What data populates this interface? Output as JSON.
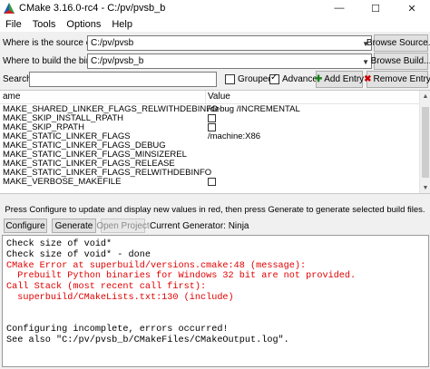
{
  "window": {
    "title": "CMake 3.16.0-rc4 - C:/pv/pvsb_b",
    "controls": {
      "minimize": "—",
      "maximize": "☐",
      "close": "✕"
    }
  },
  "menu": [
    "File",
    "Tools",
    "Options",
    "Help"
  ],
  "source": {
    "label": "Where is the source code:",
    "value": "C:/pv/pvsb",
    "button": "Browse Source..."
  },
  "build": {
    "label": "Where to build the binaries:",
    "value": "C:/pv/pvsb_b",
    "button": "Browse Build..."
  },
  "search": {
    "label": "Search:",
    "value": "",
    "grouped_label": "Grouped",
    "grouped_checked": false,
    "advanced_label": "Advanced",
    "advanced_checked": true,
    "add_entry": "Add Entry",
    "remove_entry": "Remove Entry"
  },
  "table": {
    "col_name": "ame",
    "col_value": "Value",
    "rows": [
      {
        "name": "MAKE_SHARED_LINKER_FLAGS_RELWITHDEBINFO",
        "value": "/debug /INCREMENTAL",
        "type": "text"
      },
      {
        "name": "MAKE_SKIP_INSTALL_RPATH",
        "value": "",
        "type": "bool"
      },
      {
        "name": "MAKE_SKIP_RPATH",
        "value": "",
        "type": "bool"
      },
      {
        "name": "MAKE_STATIC_LINKER_FLAGS",
        "value": "/machine:X86",
        "type": "text"
      },
      {
        "name": "MAKE_STATIC_LINKER_FLAGS_DEBUG",
        "value": "",
        "type": "text"
      },
      {
        "name": "MAKE_STATIC_LINKER_FLAGS_MINSIZEREL",
        "value": "",
        "type": "text"
      },
      {
        "name": "MAKE_STATIC_LINKER_FLAGS_RELEASE",
        "value": "",
        "type": "text"
      },
      {
        "name": "MAKE_STATIC_LINKER_FLAGS_RELWITHDEBINFO",
        "value": "",
        "type": "text"
      },
      {
        "name": "MAKE_VERBOSE_MAKEFILE",
        "value": "",
        "type": "bool"
      }
    ]
  },
  "hint": "Press Configure to update and display new values in red, then press Generate to generate selected build files.",
  "buttons": {
    "configure": "Configure",
    "generate": "Generate",
    "open_project": "Open Project"
  },
  "current_generator": "Current Generator: Ninja",
  "output": [
    {
      "text": "Check size of void*",
      "color": "black"
    },
    {
      "text": "Check size of void* - done",
      "color": "black"
    },
    {
      "text": "CMake Error at superbuild/versions.cmake:48 (message):",
      "color": "red"
    },
    {
      "text": "  Prebuilt Python binaries for Windows 32 bit are not provided.",
      "color": "red"
    },
    {
      "text": "Call Stack (most recent call first):",
      "color": "red"
    },
    {
      "text": "  superbuild/CMakeLists.txt:130 (include)",
      "color": "red"
    },
    {
      "text": "",
      "color": "black"
    },
    {
      "text": "",
      "color": "black"
    },
    {
      "text": "Configuring incomplete, errors occurred!",
      "color": "black"
    },
    {
      "text": "See also \"C:/pv/pvsb_b/CMakeFiles/CMakeOutput.log\".",
      "color": "black"
    }
  ],
  "colors": {
    "error_text": "#e00000",
    "window_bg": "#f0f0f0"
  }
}
